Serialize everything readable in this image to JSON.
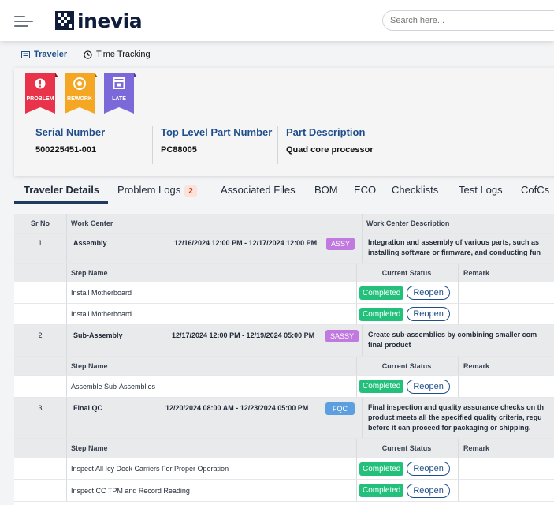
{
  "header": {
    "logo_text": "inevia",
    "search_placeholder": "Search here..."
  },
  "subnav": {
    "traveler_label": "Traveler",
    "time_tracking_label": "Time Tracking"
  },
  "flags": [
    {
      "label": "PROBLEM",
      "color": "#e8334a",
      "icon": "alert-icon"
    },
    {
      "label": "REWORK",
      "color": "#f5a623",
      "icon": "rework-icon"
    },
    {
      "label": "LATE",
      "color": "#7b68d9",
      "icon": "calendar-icon"
    }
  ],
  "info": {
    "serial_title": "Serial Number",
    "serial_value": "500225451-001",
    "top_level_title": "Top Level Part Number",
    "top_level_value": "PC88005",
    "desc_title": "Part Description",
    "desc_value": "Quad core processor"
  },
  "tabs": {
    "traveler_details": "Traveler Details",
    "problem_logs": "Problem Logs",
    "problem_logs_count": "2",
    "associated_files": "Associated Files",
    "bom": "BOM",
    "eco": "ECO",
    "checklists": "Checklists",
    "test_logs": "Test Logs",
    "cofcs": "CofCs"
  },
  "table": {
    "col_sr": "Sr No",
    "col_work_center": "Work Center",
    "col_wc_desc": "Work Center Description",
    "step_col_name": "Step Name",
    "step_col_status": "Current Status",
    "step_col_remark": "Remark",
    "completed_label": "Completed",
    "reopen_label": "Reopen",
    "work_centers": [
      {
        "sr": "1",
        "name": "Assembly",
        "dates": "12/16/2024 12:00 PM - 12/17/2024 12:00 PM",
        "code": "ASSY",
        "code_color": "#c07adf",
        "desc_line1": "Integration and assembly of various parts, such as",
        "desc_line2": "installing software or firmware, and conducting fun",
        "desc_line3": "",
        "steps": [
          "Install Motherboard",
          "Install Motherboard"
        ]
      },
      {
        "sr": "2",
        "name": "Sub-Assembly",
        "dates": "12/17/2024 12:00 PM - 12/19/2024 05:00 PM",
        "code": "SASSY",
        "code_color": "#c07adf",
        "desc_line1": "Create sub-assemblies by combining smaller com",
        "desc_line2": "final product",
        "desc_line3": "",
        "steps": [
          "Assemble Sub-Assemblies"
        ]
      },
      {
        "sr": "3",
        "name": "Final QC",
        "dates": "12/20/2024 08:00 AM - 12/23/2024 05:00 PM",
        "code": "FQC",
        "code_color": "#5b9fe0",
        "desc_line1": "Final inspection and quality assurance checks on th",
        "desc_line2": "product meets all the specified quality criteria, regu",
        "desc_line3": "before it can proceed for packaging or shipping.",
        "steps": [
          "Inspect All Icy Dock Carriers For Proper Operation",
          "Inspect CC TPM and Record Reading"
        ]
      }
    ]
  }
}
